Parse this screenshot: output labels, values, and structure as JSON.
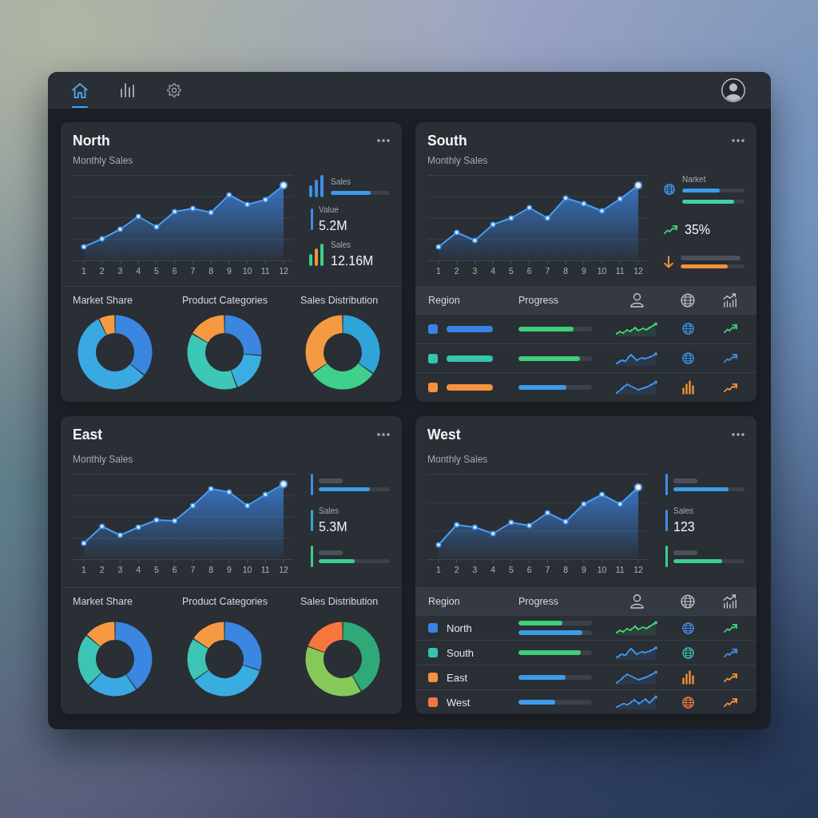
{
  "toolbar": {
    "tabs": [
      {
        "kind": "home",
        "selected": true
      },
      {
        "kind": "stats",
        "selected": false
      },
      {
        "kind": "settings",
        "selected": false
      }
    ]
  },
  "panels": [
    {
      "kind": "donuts",
      "title": "North",
      "subtitle": "Monthly Sales",
      "x_labels": [
        "1",
        "2",
        "3",
        "4",
        "5",
        "6",
        "7",
        "8",
        "9",
        "10",
        "11",
        "12"
      ],
      "stats": [
        {
          "kind": "bars",
          "color": "#3d8fe6",
          "label": "Sales",
          "bars": [
            {
              "color": "#3d9be9",
              "level": 0.67
            }
          ]
        },
        {
          "kind": "accent",
          "color": "#3d8fe6",
          "label": "Value",
          "value": "5.2M"
        },
        {
          "kind": "multibars",
          "label": "Sales",
          "value": "12.16M"
        }
      ],
      "donuts": [
        {
          "title": "Market Share"
        },
        {
          "title": "Product Categories"
        },
        {
          "title": "Sales Distribution"
        }
      ]
    },
    {
      "kind": "table",
      "title": "South",
      "subtitle": "Monthly Sales",
      "x_labels": [
        "1",
        "2",
        "3",
        "4",
        "5",
        "6",
        "7",
        "8",
        "9",
        "10",
        "11",
        "12"
      ],
      "stats": [
        {
          "kind": "globe",
          "color": "#3d8fe6",
          "label": "Narket",
          "bars": [
            {
              "color": "#3d9be9",
              "level": 0.6
            },
            {
              "color": "#41d1a6",
              "level": 0.83
            }
          ]
        },
        {
          "kind": "trend",
          "color": "#3ecf7a",
          "value": "35%"
        },
        {
          "kind": "arrow-down",
          "color": "#f0923a",
          "skeleton": true,
          "bars": [
            {
              "color": "#f0923a",
              "level": 0.74
            }
          ]
        }
      ],
      "table": {
        "columns": [
          "Region",
          "Progress"
        ],
        "rows": [
          {
            "color": "#3b82e6",
            "bars": [
              {
                "color": "#3ecf7a",
                "level": 0.75
              }
            ],
            "sparkline": {
              "color": "#3ecf6a"
            },
            "region_icon": {
              "kind": "globe",
              "color": "#3d8fe6"
            },
            "trend": {
              "color": "#3ecf7a"
            }
          },
          {
            "color": "#35c4ad",
            "bars": [
              {
                "color": "#3ecf7a",
                "level": 0.84
              }
            ],
            "sparkline": {
              "color": "#3d8fe6"
            },
            "region_icon": {
              "kind": "globe",
              "color": "#3d8fe6"
            },
            "trend": {
              "color": "#3d8fe6"
            }
          },
          {
            "color": "#f5923e",
            "bars": [
              {
                "color": "#3d9be9",
                "level": 0.65
              }
            ],
            "sparkline": {
              "color": "#3d8fe6"
            },
            "region_icon": {
              "kind": "bars",
              "color": "#f0923a"
            },
            "trend": {
              "color": "#f0923a"
            }
          }
        ]
      }
    },
    {
      "kind": "donuts",
      "title": "East",
      "subtitle": "Monthly Sales",
      "x_labels": [
        "1",
        "2",
        "3",
        "4",
        "5",
        "6",
        "7",
        "8",
        "9",
        "10",
        "11",
        "12"
      ],
      "stats": [
        {
          "kind": "accent",
          "color": "#3d8fe6",
          "skeleton": true,
          "bars": [
            {
              "color": "#3d9be9",
              "level": 0.72
            }
          ]
        },
        {
          "kind": "accent",
          "color": "#3aa0d8",
          "label": "Sales",
          "value": "5.3M"
        },
        {
          "kind": "accent",
          "color": "#3ecf8a",
          "skeleton": true,
          "bars": [
            {
              "color": "#3ecf8a",
              "level": 0.51
            }
          ]
        }
      ],
      "donuts": [
        {
          "title": "Market Share"
        },
        {
          "title": "Product Categories"
        },
        {
          "title": "Sales Distribution"
        }
      ]
    },
    {
      "kind": "table",
      "title": "West",
      "subtitle": "Monthly Sales",
      "x_labels": [
        "1",
        "2",
        "3",
        "4",
        "5",
        "6",
        "7",
        "8",
        "9",
        "10",
        "11",
        "12"
      ],
      "stats": [
        {
          "kind": "accent",
          "color": "#3d8fe6",
          "skeleton": true,
          "bars": [
            {
              "color": "#3d9be9",
              "level": 0.77
            }
          ]
        },
        {
          "kind": "accent",
          "color": "#3d8fe6",
          "label": "Sales",
          "value": "123"
        },
        {
          "kind": "accent",
          "color": "#3ecf8a",
          "skeleton": true,
          "bars": [
            {
              "color": "#3ecf8a",
              "level": 0.69
            }
          ]
        }
      ],
      "table": {
        "columns": [
          "Region",
          "Progress"
        ],
        "rows": [
          {
            "color": "#3b82e6",
            "name": "North",
            "bars": [
              {
                "color": "#3ecf7a",
                "level": 0.6
              },
              {
                "color": "#3d9be9",
                "level": 0.87
              }
            ],
            "sparkline": {
              "color": "#3ecf6a"
            },
            "region_icon": {
              "kind": "globe",
              "color": "#3d8fe6"
            },
            "trend": {
              "color": "#3ecf7a"
            }
          },
          {
            "color": "#35c4ad",
            "name": "South",
            "bars": [
              {
                "color": "#3ecf7a",
                "level": 0.85
              }
            ],
            "sparkline": {
              "color": "#3d8fe6"
            },
            "region_icon": {
              "kind": "globe",
              "color": "#3fb3b0"
            },
            "trend": {
              "color": "#3d8fe6"
            }
          },
          {
            "color": "#f5923e",
            "name": "East",
            "bars": [
              {
                "color": "#3d9be9",
                "level": 0.64
              }
            ],
            "sparkline": {
              "color": "#3d8fe6"
            },
            "region_icon": {
              "kind": "bars",
              "color": "#f0923a"
            },
            "trend": {
              "color": "#f0923a"
            }
          },
          {
            "color": "#f27640",
            "name": "West",
            "bars": [
              {
                "color": "#3d9be9",
                "level": 0.5
              }
            ],
            "sparkline": {
              "color": "#3d8fe6"
            },
            "region_icon": {
              "kind": "globe",
              "color": "#ef7a45"
            },
            "trend": {
              "color": "#f0923a"
            }
          }
        ]
      }
    }
  ]
}
